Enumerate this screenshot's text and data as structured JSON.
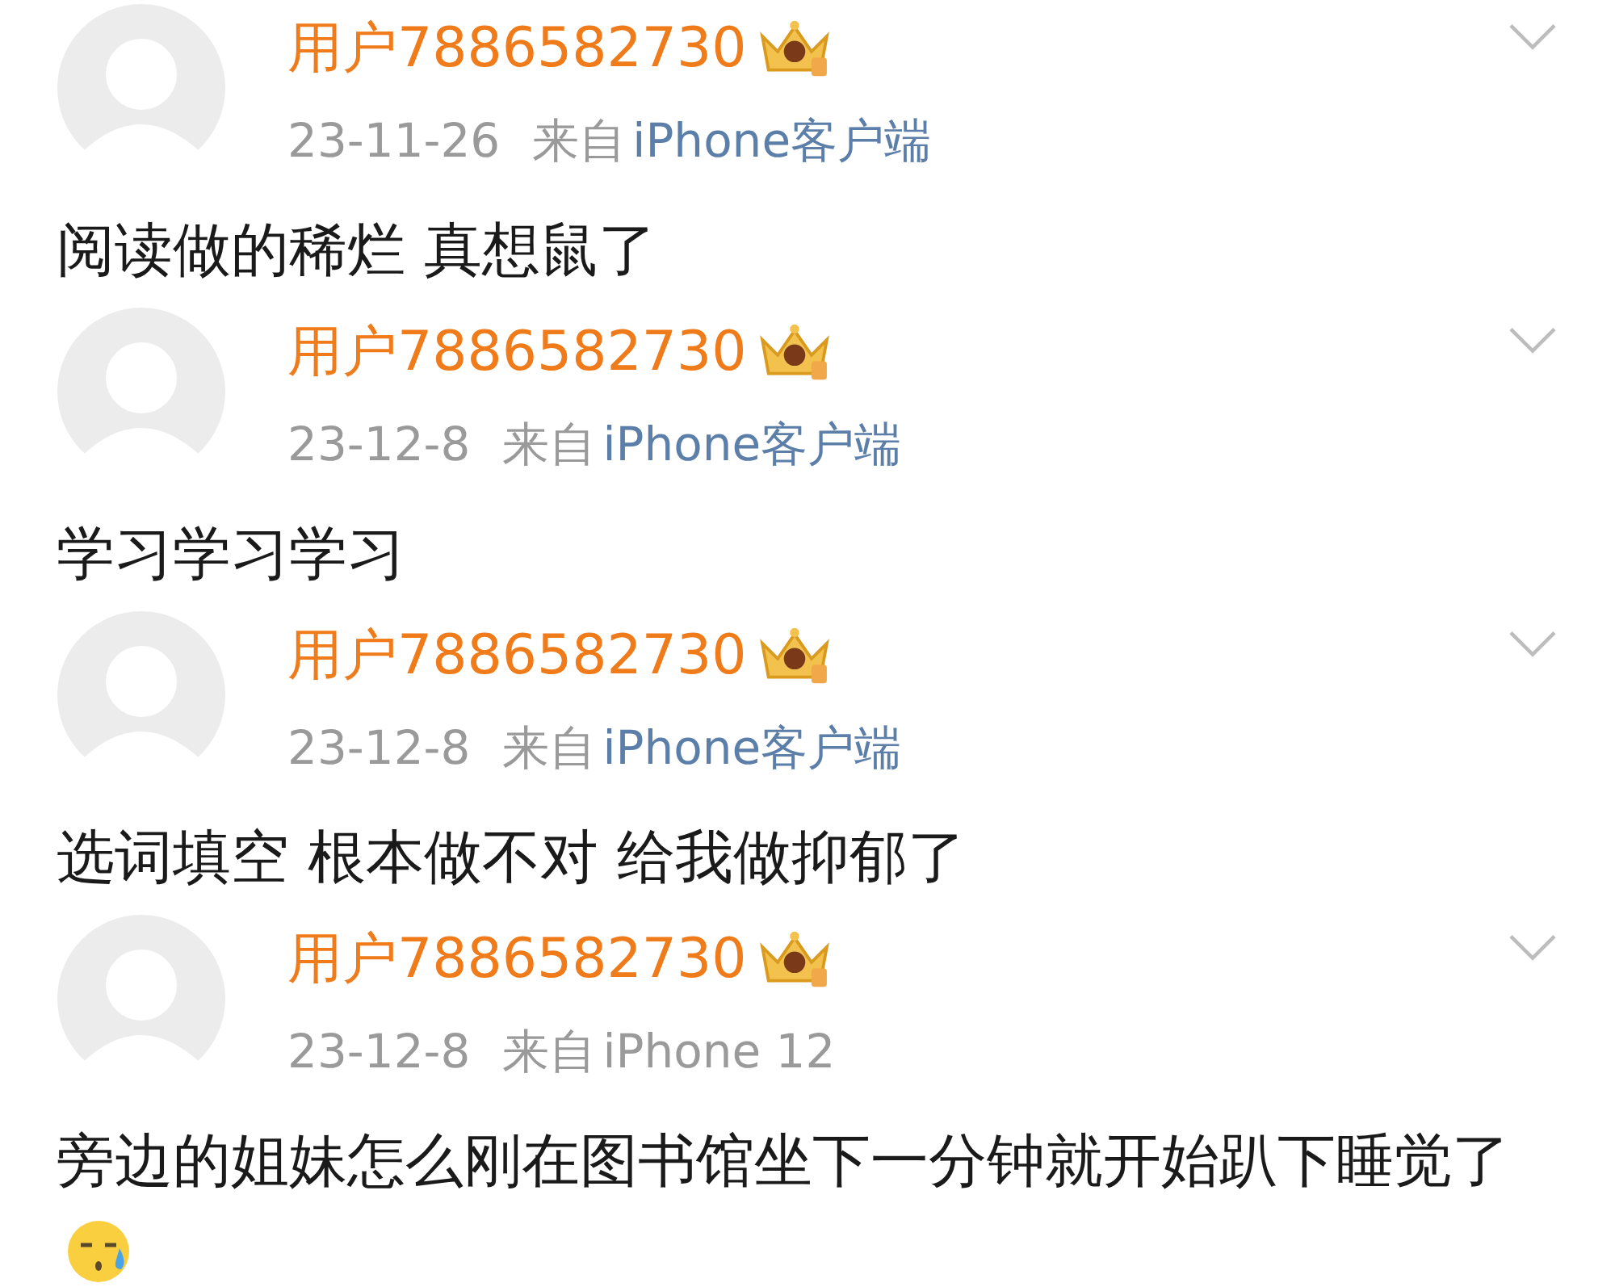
{
  "comments": [
    {
      "username": "用户7886582730",
      "date": "23-11-26",
      "source_prefix": "来自",
      "source": "iPhone客户端",
      "source_linked": true,
      "text": "阅读做的稀烂 真想鼠了",
      "trailing_emoji": false
    },
    {
      "username": "用户7886582730",
      "date": "23-12-8",
      "source_prefix": "来自",
      "source": "iPhone客户端",
      "source_linked": true,
      "text": "学习学习学习",
      "trailing_emoji": false
    },
    {
      "username": "用户7886582730",
      "date": "23-12-8",
      "source_prefix": "来自",
      "source": "iPhone客户端",
      "source_linked": true,
      "text": "选词填空 根本做不对 给我做抑郁了",
      "trailing_emoji": false
    },
    {
      "username": "用户7886582730",
      "date": "23-12-8",
      "source_prefix": "来自",
      "source": "iPhone 12",
      "source_linked": false,
      "text": "旁边的姐妹怎么刚在图书馆坐下一分钟就开始趴下睡觉了",
      "trailing_emoji": true
    }
  ]
}
